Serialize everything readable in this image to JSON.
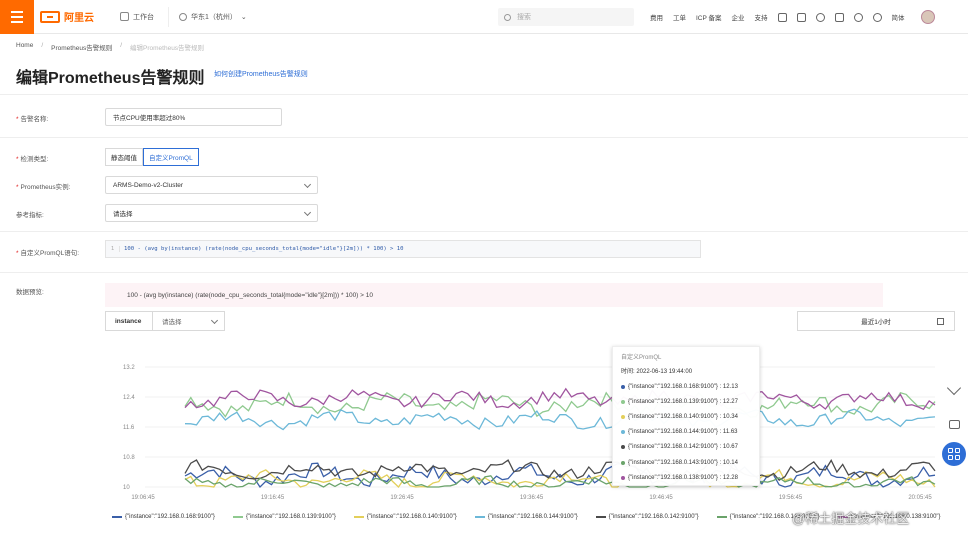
{
  "topbar": {
    "logo_text": "阿里云",
    "workbench": "工作台",
    "region": "华东1（杭州）",
    "search_placeholder": "搜索",
    "links": [
      "费用",
      "工单",
      "ICP 备案",
      "企业",
      "支持"
    ],
    "lang": "简体"
  },
  "breadcrumb": [
    "Home",
    "Prometheus告警规则",
    "编辑Prometheus告警规则"
  ],
  "page": {
    "title": "编辑Prometheus告警规则",
    "help_link": "如何创建Prometheus告警规则"
  },
  "form": {
    "alert_name_label": "告警名称:",
    "alert_name_value": "节点CPU使用率超过80%",
    "detect_type_label": "检测类型:",
    "detect_types": [
      "静态阈值",
      "自定义PromQL"
    ],
    "prom_instance_label": "Prometheus实例:",
    "prom_instance_value": "ARMS-Demo-v2-Cluster",
    "ref_metric_label": "参考指标:",
    "ref_metric_placeholder": "请选择",
    "promql_label": "自定义PromQL语句:",
    "promql_line": "1",
    "promql_value": "100 - (avg by(instance) (rate(node_cpu_seconds_total{mode=\"idle\"}[2m])) * 100) > 10",
    "preview_label": "数据预览:",
    "preview_query": "100 - (avg by(instance) (rate(node_cpu_seconds_total{mode=\"idle\"}[2m])) * 100) > 10",
    "filter_key": "instance",
    "filter_placeholder": "请选择",
    "time_range": "最近1小时"
  },
  "chart_data": {
    "type": "line",
    "y_ticks": [
      "13.2",
      "12.4",
      "11.6",
      "10.8",
      "10"
    ],
    "x_ticks": [
      "19:06:45",
      "19:16:45",
      "19:26:45",
      "19:36:45",
      "19:46:45",
      "19:56:45",
      "20:05:45"
    ],
    "ylim": [
      10,
      13.2
    ],
    "grid": true,
    "legend_position": "bottom",
    "series": [
      {
        "name": "{\"instance\":\"192.168.0.168:9100\"}",
        "color": "#3a5fa8",
        "base": 10.3,
        "amp": 0.25
      },
      {
        "name": "{\"instance\":\"192.168.0.139:9100\"}",
        "color": "#8fc98f",
        "base": 12.2,
        "amp": 0.25
      },
      {
        "name": "{\"instance\":\"192.168.0.140:9100\"}",
        "color": "#e3cf5a",
        "base": 10.2,
        "amp": 0.2
      },
      {
        "name": "{\"instance\":\"192.168.0.144:9100\"}",
        "color": "#6cb8d8",
        "base": 11.8,
        "amp": 0.2
      },
      {
        "name": "{\"instance\":\"192.168.0.142:9100\"}",
        "color": "#4b4b4b",
        "base": 10.45,
        "amp": 0.2
      },
      {
        "name": "{\"instance\":\"192.168.0.143:9100\"}",
        "color": "#6aa36a",
        "base": 10.1,
        "amp": 0.15
      },
      {
        "name": "{\"instance\":\"192.168.0.138:9100\"}",
        "color": "#a0559f",
        "base": 12.35,
        "amp": 0.2
      }
    ],
    "tooltip": {
      "title": "自定义PromQL",
      "time": "时间: 2022-06-13 19:44:00",
      "rows": [
        {
          "name": "{\"instance\":\"192.168.0.168:9100\"}",
          "value": "12.13",
          "color": "#3a5fa8"
        },
        {
          "name": "{\"instance\":\"192.168.0.139:9100\"}",
          "value": "12.27",
          "color": "#8fc98f"
        },
        {
          "name": "{\"instance\":\"192.168.0.140:9100\"}",
          "value": "10.34",
          "color": "#e3cf5a"
        },
        {
          "name": "{\"instance\":\"192.168.0.144:9100\"}",
          "value": "11.63",
          "color": "#6cb8d8"
        },
        {
          "name": "{\"instance\":\"192.168.0.142:9100\"}",
          "value": "10.67",
          "color": "#4b4b4b"
        },
        {
          "name": "{\"instance\":\"192.168.0.143:9100\"}",
          "value": "10.14",
          "color": "#6aa36a"
        },
        {
          "name": "{\"instance\":\"192.168.0.138:9100\"}",
          "value": "12.28",
          "color": "#a0559f"
        }
      ]
    }
  },
  "watermark": "@稀土掘金技术社区"
}
